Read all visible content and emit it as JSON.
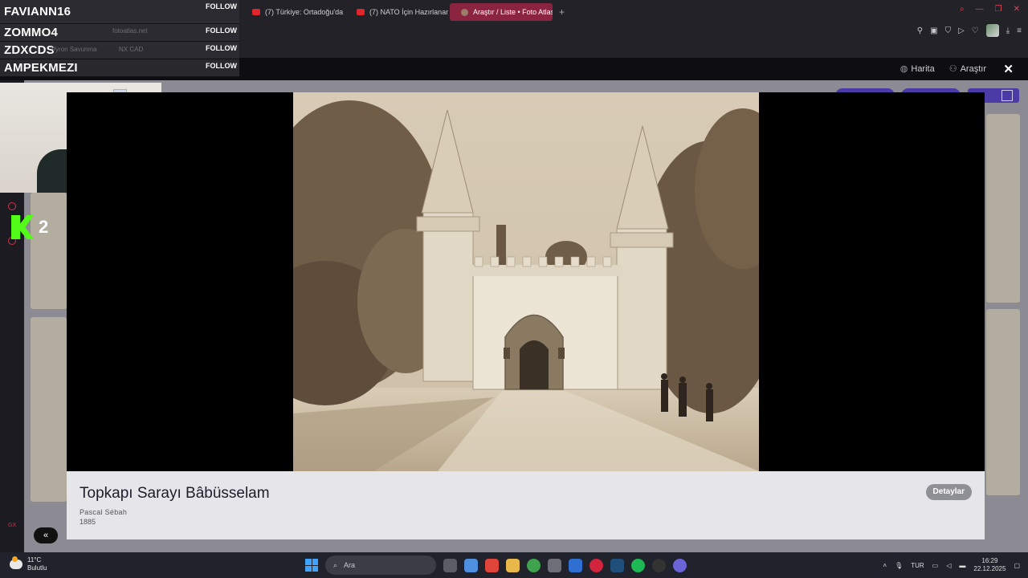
{
  "browser": {
    "tabs": [
      {
        "label": "(7) Türkiye: Ortadoğu'da",
        "icon": "youtube-icon",
        "active": false
      },
      {
        "label": "(7) NATO İçin Hazırlanan",
        "icon": "youtube-icon",
        "active": false
      },
      {
        "label": "Araştır / Liste • Foto Atlas",
        "icon": "fotoatlas-icon",
        "active": true
      }
    ],
    "new_tab_glyph": "+",
    "url_faint": "fotoatlas.net",
    "bookmark_faint_1": "Vyron Savunma",
    "bookmark_faint_2": "NX CAD"
  },
  "stream_overlay": {
    "follows": [
      {
        "name": "FAVIANN16",
        "action": "FOLLOW"
      },
      {
        "name": "ZOMMO4",
        "action": "FOLLOW"
      },
      {
        "name": "ZDXCDS",
        "action": "FOLLOW"
      },
      {
        "name": "AMPEKMEZI",
        "action": "FOLLOW"
      }
    ],
    "badge_number": "2"
  },
  "site": {
    "nav": [
      {
        "label": "Harita",
        "icon": "globe-icon"
      },
      {
        "label": "Araştır",
        "icon": "person-icon"
      }
    ],
    "close_glyph": "✕",
    "pager_glyph": "«",
    "rail_label": "GX"
  },
  "lightbox": {
    "title": "Topkapı Sarayı Bâbüsselam",
    "author": "Pascal Sébah",
    "year": "1885",
    "details_label": "Detaylar"
  },
  "taskbar": {
    "weather_temp": "11°C",
    "weather_desc": "Bulutlu",
    "search_placeholder": "Ara",
    "language": "TUR",
    "time": "16:29",
    "date": "22.12.2025"
  },
  "colors": {
    "accent_tab": "#8a2440",
    "kick_green": "#53fc18",
    "caption_bg": "#e6e6ea"
  }
}
